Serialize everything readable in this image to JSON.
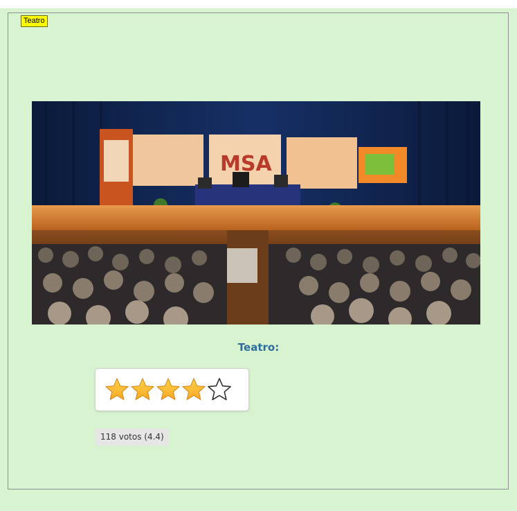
{
  "fieldset": {
    "legend": "Teatro"
  },
  "photo": {
    "subject": "conference-stage-photo"
  },
  "caption": "Teatro:",
  "rating": {
    "value_stars": 4,
    "max_stars": 5,
    "filled_color": "#f7a823",
    "empty_color": "#ffffff"
  },
  "votes_text": "118 votos (4.4)"
}
